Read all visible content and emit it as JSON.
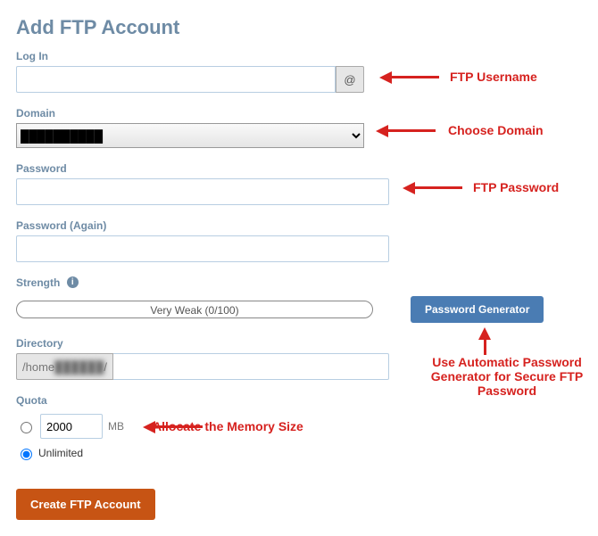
{
  "title": "Add FTP Account",
  "labels": {
    "login": "Log In",
    "domain": "Domain",
    "password": "Password",
    "password_again": "Password (Again)",
    "strength": "Strength",
    "directory": "Directory",
    "quota": "Quota",
    "unlimited": "Unlimited"
  },
  "login": {
    "value": "",
    "at": "@"
  },
  "domain": {
    "selected": "██████████"
  },
  "password": {
    "value": ""
  },
  "password_again": {
    "value": ""
  },
  "strength": {
    "text": "Very Weak (0/100)",
    "button": "Password Generator"
  },
  "directory": {
    "prefix_before": "/home",
    "prefix_blur": "██████",
    "prefix_after": "/",
    "value": ""
  },
  "quota": {
    "value": "2000",
    "unit": "MB",
    "selected": "unlimited"
  },
  "submit": {
    "label": "Create FTP Account"
  },
  "annotations": {
    "username": "FTP Username",
    "choose_domain": "Choose Domain",
    "ftp_password": "FTP Password",
    "generator_note": "Use Automatic Password Generator for Secure FTP Password",
    "memory": "Allocate the Memory Size"
  },
  "info_icon": "i"
}
